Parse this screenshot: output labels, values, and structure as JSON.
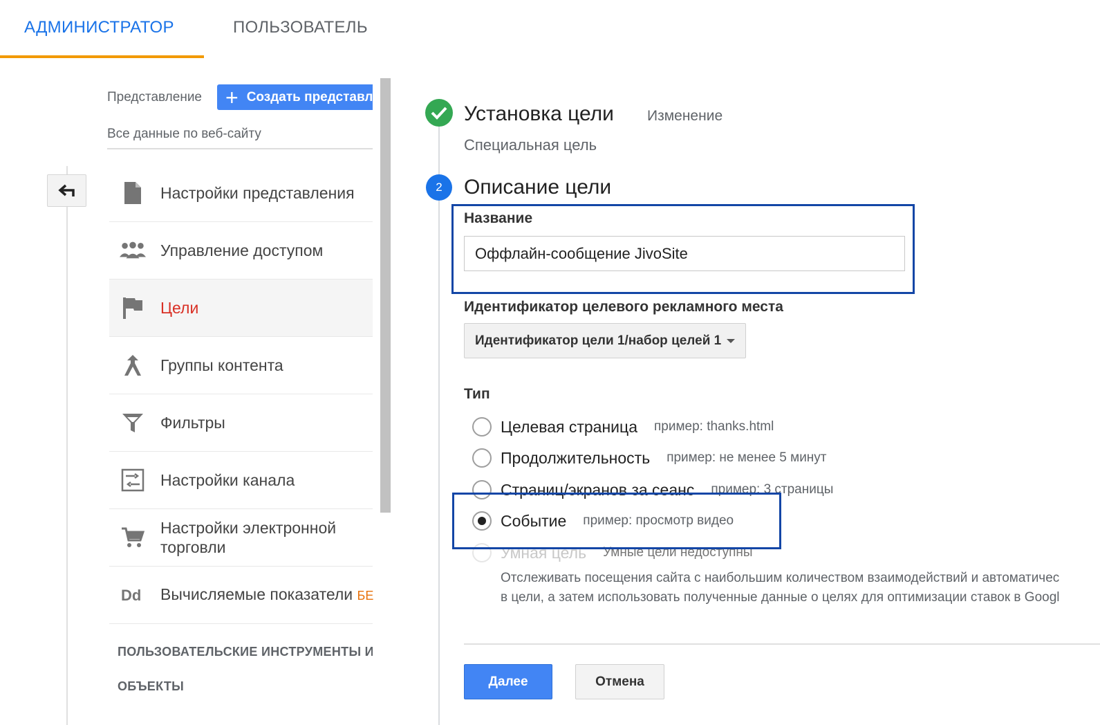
{
  "tabs": {
    "admin": "АДМИНИСТРАТОР",
    "user": "ПОЛЬЗОВАТЕЛЬ"
  },
  "left": {
    "view_label": "Представление",
    "create_view_label": "Создать представл",
    "view_select": "Все данные по веб-сайту",
    "menu": [
      {
        "label": "Настройки представления",
        "icon": "document-icon"
      },
      {
        "label": "Управление доступом",
        "icon": "people-icon"
      },
      {
        "label": "Цели",
        "icon": "flag-icon"
      },
      {
        "label": "Группы контента",
        "icon": "content-group-icon"
      },
      {
        "label": "Фильтры",
        "icon": "filter-icon"
      },
      {
        "label": "Настройки канала",
        "icon": "channel-settings-icon"
      },
      {
        "label": "Настройки электронной торговли",
        "icon": "cart-icon"
      },
      {
        "label": "Вычисляемые показатели",
        "badge": "БЕ",
        "icon": "dd-icon"
      }
    ],
    "section_tools": "ПОЛЬЗОВАТЕЛЬСКИЕ ИНСТРУМЕНТЫ И",
    "section_objects": "ОБЪЕКТЫ"
  },
  "wizard": {
    "step1": {
      "title": "Установка цели",
      "edit": "Изменение",
      "subtitle": "Специальная цель"
    },
    "step2": {
      "number": "2",
      "title": "Описание цели",
      "name_label": "Название",
      "name_value": "Оффлайн-сообщение JivoSite",
      "slot_label": "Идентификатор целевого рекламного места",
      "slot_value": "Идентификатор цели 1/набор целей 1",
      "type_label": "Тип",
      "types": [
        {
          "label": "Целевая страница",
          "example": "пример: thanks.html"
        },
        {
          "label": "Продолжительность",
          "example": "пример: не менее 5 минут"
        },
        {
          "label": "Страниц/экранов за сеанс",
          "example": "пример: 3 страницы"
        },
        {
          "label": "Событие",
          "example": "пример: просмотр видео"
        },
        {
          "label": "Умная цель",
          "example": "Умные цели недоступны"
        }
      ],
      "smart_desc_1": "Отслеживать посещения сайта с наибольшим количеством взаимодействий и автоматичес",
      "smart_desc_2": "в цели, а затем использовать полученные данные о целях для оптимизации ставок в Googl"
    },
    "next_label": "Далее",
    "cancel_label": "Отмена"
  },
  "colors": {
    "accent_blue": "#1a73e8",
    "tab_underline": "#f29900",
    "active_menu": "#d93025",
    "success_green": "#34a853",
    "highlight_box": "#1346a6"
  }
}
